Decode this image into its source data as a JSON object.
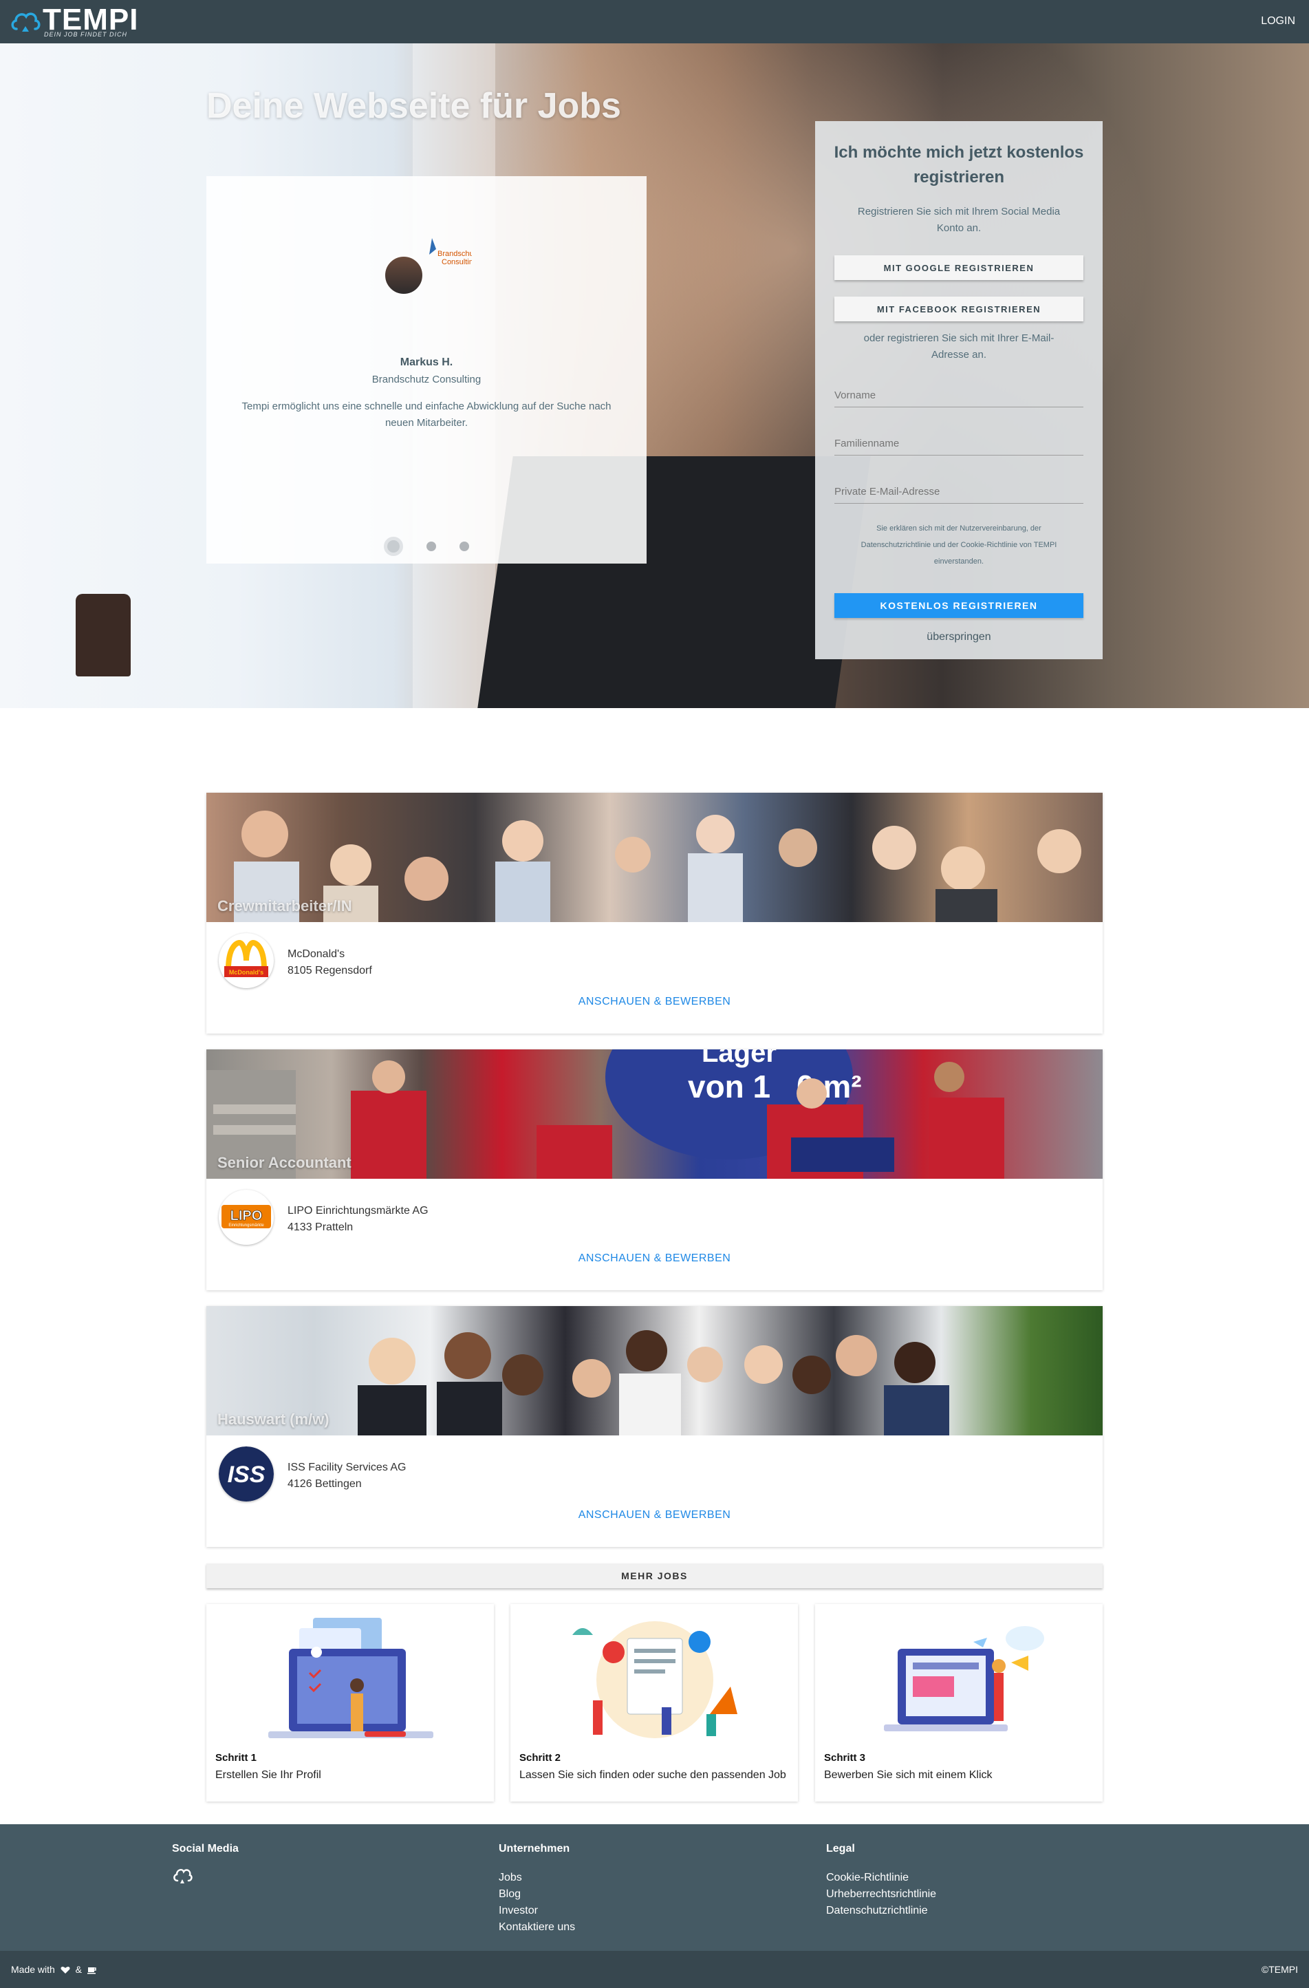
{
  "nav": {
    "brand": "TEMPI",
    "tagline": "DEIN JOB FINDET DICH",
    "login": "LOGIN"
  },
  "hero": {
    "title": "Deine Webseite für Jobs",
    "testimonial": {
      "logo_text_1": "Brandschutz",
      "logo_text_2": "Consulting",
      "name": "Markus H.",
      "company": "Brandschutz Consulting",
      "quote": "Tempi ermöglicht uns eine schnelle und einfache Abwicklung auf der Suche nach neuen Mitarbeiter."
    }
  },
  "register": {
    "title": "Ich möchte mich jetzt kostenlos registrieren",
    "social_intro": "Registrieren Sie sich mit Ihrem Social Media Konto an.",
    "google": "MIT GOOGLE REGISTRIEREN",
    "facebook": "MIT FACEBOOK REGISTRIEREN",
    "email_intro": "oder registrieren Sie sich mit Ihrer E-Mail-Adresse an.",
    "first_name_placeholder": "Vorname",
    "last_name_placeholder": "Familienname",
    "email_placeholder": "Private E-Mail-Adresse",
    "legal": "Sie erklären sich mit der Nutzervereinbarung, der Datenschutzrichtlinie und der Cookie-Richtlinie von TEMPI einverstanden.",
    "submit": "KOSTENLOS REGISTRIEREN",
    "skip": "überspringen"
  },
  "jobs": [
    {
      "title": "Crewmitarbeiter/IN",
      "company": "McDonald's",
      "location": "8105 Regensdorf",
      "apply": "ANSCHAUEN & BEWERBEN",
      "logo_text": "McDonald's"
    },
    {
      "title": "Senior Accountant",
      "company": "LIPO Einrichtungsmärkte AG",
      "location": "4133 Pratteln",
      "apply": "ANSCHAUEN & BEWERBEN",
      "logo_text": "LIPO",
      "logo_sub": "Einrichtungsmärkte",
      "banner_text": "von 1",
      "banner_text2": "0 m²",
      "banner_text3": "Lager"
    },
    {
      "title": "Hauswart (m/w)",
      "company": "ISS Facility Services AG",
      "location": "4126 Bettingen",
      "apply": "ANSCHAUEN & BEWERBEN",
      "logo_text": "ISS"
    }
  ],
  "more_jobs": "MEHR JOBS",
  "steps": [
    {
      "number": "Schritt 1",
      "text": "Erstellen Sie Ihr Profil"
    },
    {
      "number": "Schritt 2",
      "text": "Lassen Sie sich finden oder suche den passenden Job"
    },
    {
      "number": "Schritt 3",
      "text": "Bewerben Sie sich mit einem Klick"
    }
  ],
  "footer": {
    "social_title": "Social Media",
    "company_title": "Unternehmen",
    "company_links": [
      "Jobs",
      "Blog",
      "Investor",
      "Kontaktiere uns"
    ],
    "legal_title": "Legal",
    "legal_links": [
      "Cookie-Richtlinie",
      "Urheberrechtsrichtlinie",
      "Datenschutzrichtlinie"
    ],
    "made_with": "Made with",
    "made_and": "&",
    "copyright": "©TEMPI"
  },
  "colors": {
    "nav_bg": "#37474f",
    "footer_bg": "#455a64",
    "primary": "#2196f3",
    "link": "#1e88e5"
  }
}
